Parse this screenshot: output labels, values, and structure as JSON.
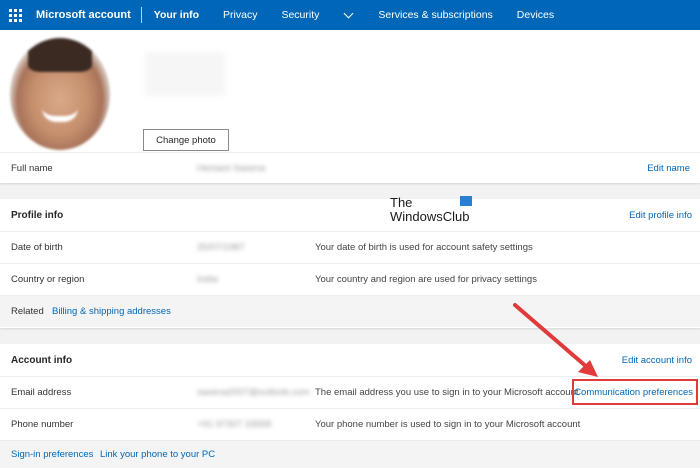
{
  "header": {
    "brand": "Microsoft account",
    "nav": [
      {
        "label": "Your info",
        "active": true
      },
      {
        "label": "Privacy"
      },
      {
        "label": "Security"
      },
      {
        "label": "Services & subscriptions"
      },
      {
        "label": "Devices"
      }
    ],
    "colors": {
      "bar": "#0067b8"
    }
  },
  "photo": {
    "change_photo_label": "Change photo"
  },
  "name_row": {
    "label": "Full name",
    "value": "Hemant Saxena",
    "edit_label": "Edit name"
  },
  "profile": {
    "title": "Profile info",
    "edit_label": "Edit profile info",
    "rows": [
      {
        "label": "Date of birth",
        "value": "25/07/1987",
        "desc": "Your date of birth is used for account safety settings"
      },
      {
        "label": "Country or region",
        "value": "India",
        "desc": "Your country and region are used for privacy settings"
      }
    ],
    "related_label": "Related",
    "related_link": "Billing & shipping addresses"
  },
  "account": {
    "title": "Account info",
    "edit_label": "Edit account info",
    "email": {
      "label": "Email address",
      "value": "saxena2007@outlook.com",
      "desc": "The email address you use to sign in to your Microsoft account",
      "link": "Communication preferences"
    },
    "phone": {
      "label": "Phone number",
      "value": "+91 97307 33558",
      "desc": "Your phone number is used to sign in to your Microsoft account"
    },
    "footer_links": [
      "Sign-in preferences",
      "Link your phone to your PC"
    ]
  },
  "watermark": {
    "line1": "The",
    "line2": "WindowsClub"
  },
  "annotation": {
    "color": "#e03a3a"
  }
}
